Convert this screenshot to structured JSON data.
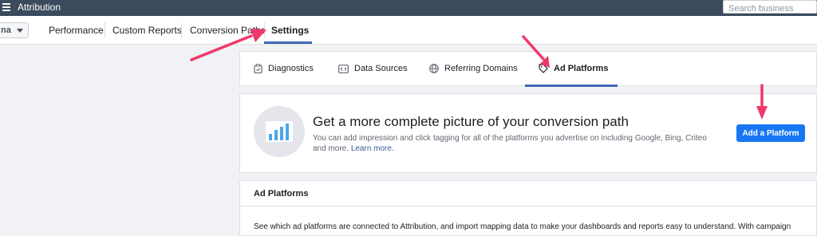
{
  "topbar": {
    "title": "Attribution",
    "search_placeholder": "Search business"
  },
  "nav": {
    "account_label": "na",
    "items": [
      {
        "label": "Performance"
      },
      {
        "label": "Custom Reports"
      },
      {
        "label": "Conversion Paths"
      },
      {
        "label": "Settings",
        "active": true
      }
    ]
  },
  "tabs": [
    {
      "label": "Diagnostics",
      "icon": "clipboard-icon"
    },
    {
      "label": "Data Sources",
      "icon": "code-icon"
    },
    {
      "label": "Referring Domains",
      "icon": "globe-icon"
    },
    {
      "label": "Ad Platforms",
      "icon": "tag-icon",
      "active": true
    }
  ],
  "promo": {
    "title": "Get a more complete picture of your conversion path",
    "text": "You can add impression and click tagging for all of the platforms you advertise on including Google, Bing, Criteo and more.",
    "link": "Learn more.",
    "button": "Add a Platform",
    "icon": "bar-chart-icon"
  },
  "ad_platforms": {
    "title": "Ad Platforms",
    "description": "See which ad platforms are connected to Attribution, and import mapping data to make your dashboards and reports easy to understand. With campaign"
  },
  "colors": {
    "topbar": "#3b4a5c",
    "accent": "#4267b2",
    "button": "#1877f2",
    "annotation_arrow": "#f0386b"
  }
}
